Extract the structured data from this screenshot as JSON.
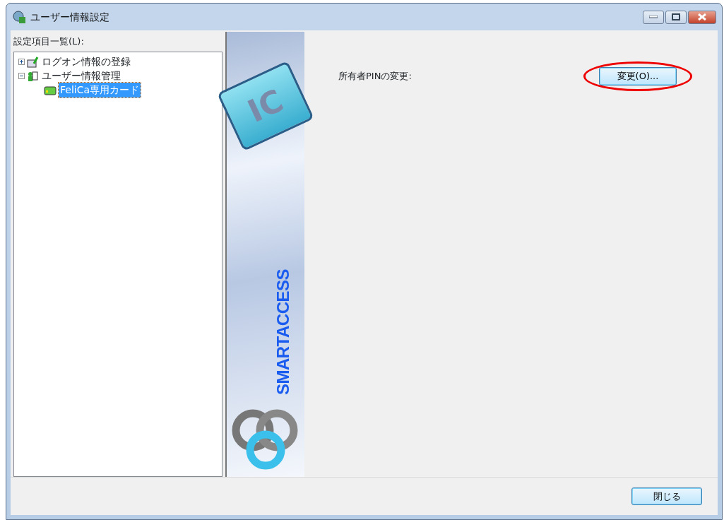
{
  "window": {
    "title": "ユーザー情報設定"
  },
  "sidebar": {
    "label": "設定項目一覧(L):",
    "items": [
      {
        "label": "ログオン情報の登録",
        "kind": "logon",
        "expanded": false,
        "selected": false
      },
      {
        "label": "ユーザー情報管理",
        "kind": "user",
        "expanded": true,
        "selected": false,
        "children": [
          {
            "label": "FeliCa専用カード",
            "kind": "card",
            "selected": true
          }
        ]
      }
    ]
  },
  "banner": {
    "logo_text": "IC",
    "brand": "SMARTACCESS"
  },
  "settings": [
    {
      "label": "所有者PINの変更:",
      "button": "変更(O)...",
      "highlighted": true
    }
  ],
  "footer": {
    "buttons": [
      "閉じる"
    ]
  }
}
